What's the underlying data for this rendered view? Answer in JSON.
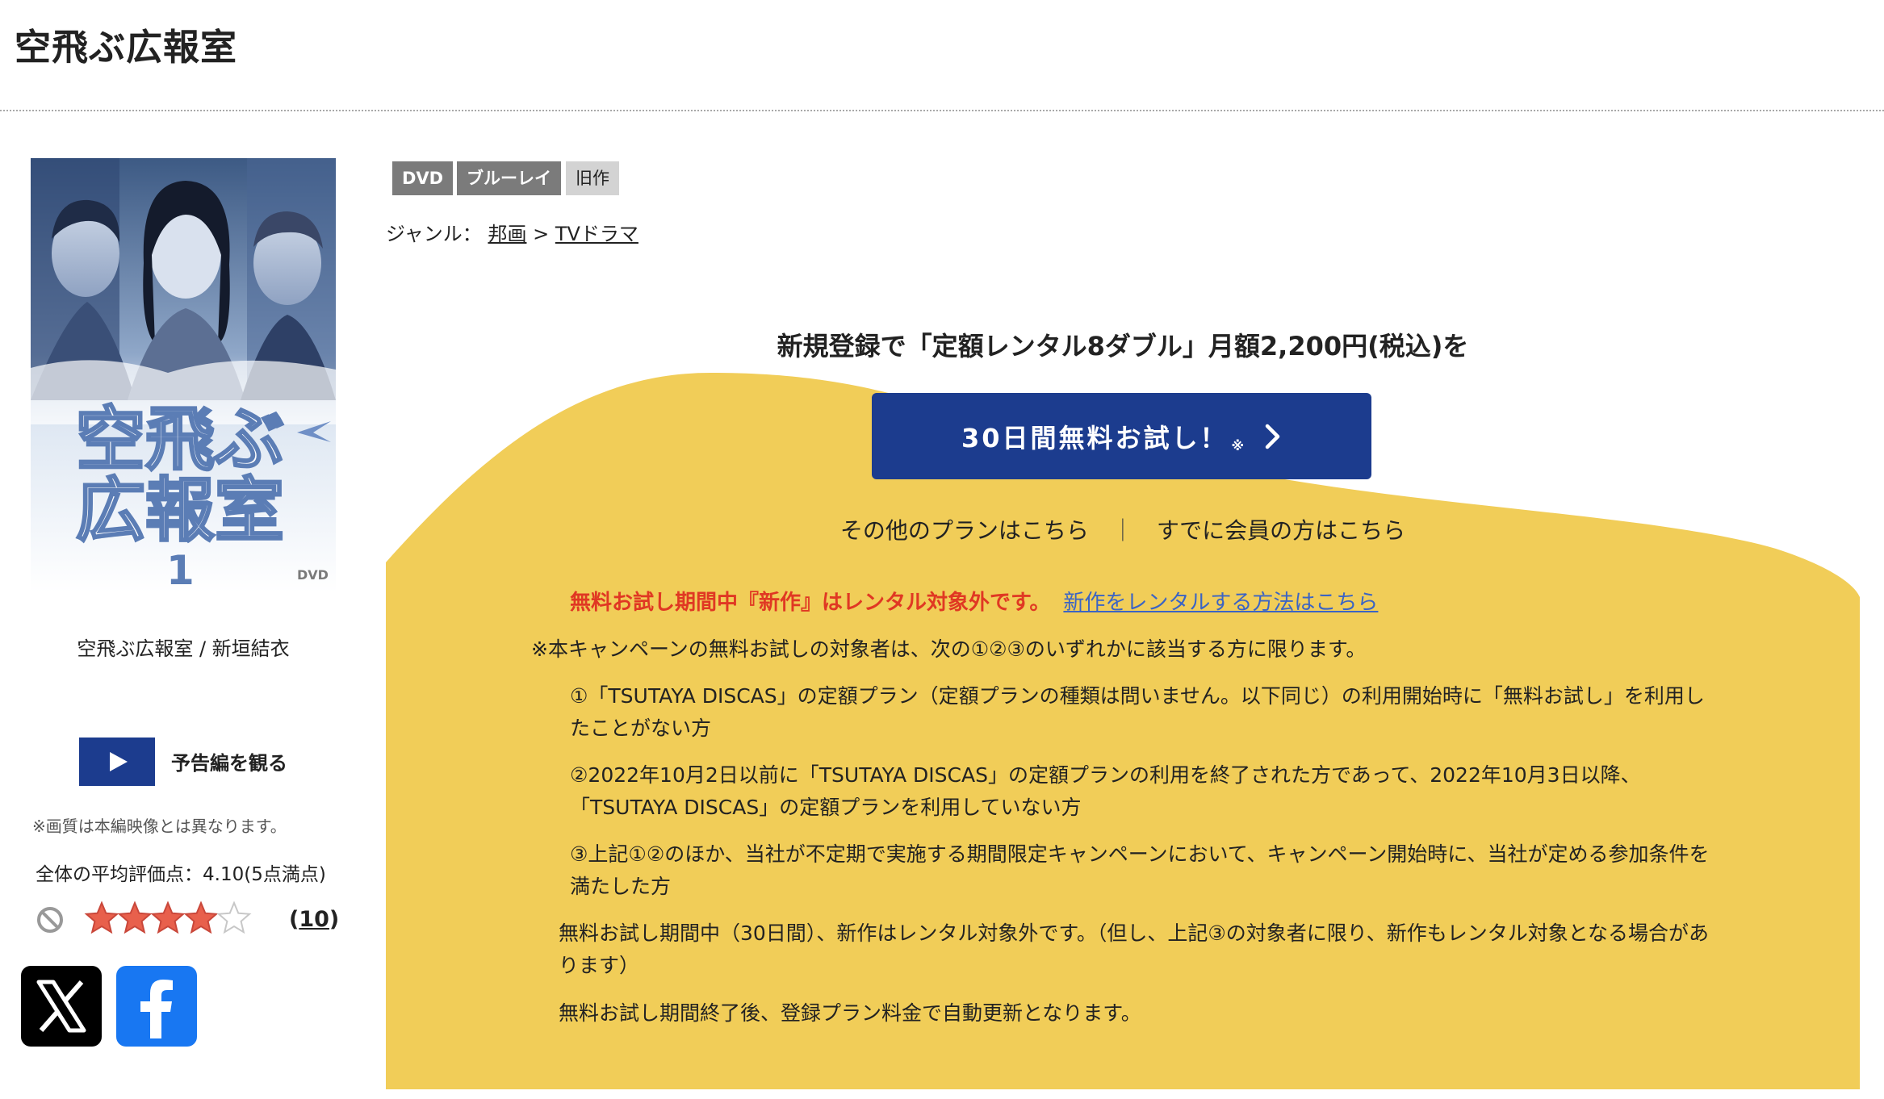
{
  "page": {
    "title": "空飛ぶ広報室"
  },
  "cover": {
    "title_line1": "空飛ぶ",
    "title_line2": "広報室",
    "volume": "1",
    "format_mark": "DVD"
  },
  "product": {
    "caption": "空飛ぶ広報室 / 新垣結衣"
  },
  "trailer": {
    "label": "予告編を観る"
  },
  "image_note": "※画質は本編映像とは異なります。",
  "rating": {
    "avg_label": "全体の平均評価点：",
    "avg_value": "4.10",
    "avg_suffix": "(5点満点)",
    "stars_filled": 4,
    "stars_total": 5,
    "review_count_open": "(",
    "review_count": "10",
    "review_count_close": ")"
  },
  "tags": {
    "dvd": "DVD",
    "bluray": "ブルーレイ",
    "old": "旧作"
  },
  "genre": {
    "label": "ジャンル：",
    "level1": "邦画",
    "separator": ">",
    "level2": "TVドラマ"
  },
  "campaign": {
    "headline": "新規登録で「定額レンタル8ダブル」月額2,200円(税込)を",
    "trial_button": "30日間無料お試し！",
    "trial_mark": "※",
    "other_plans": "その他のプランはこちら",
    "separator": "｜",
    "members": "すでに会員の方はこちら",
    "warning": "無料お試し期間中『新作』はレンタル対象外です。",
    "new_release_link": "新作をレンタルする方法はこちら",
    "note_intro": "※本キャンペーンの無料お試しの対象者は、次の①②③のいずれかに該当する方に限ります。",
    "cond1": "①「TSUTAYA DISCAS」の定額プラン（定額プランの種類は問いません。以下同じ）の利用開始時に「無料お試し」を利用したことがない方",
    "cond2": "②2022年10月2日以前に「TSUTAYA DISCAS」の定額プランの利用を終了された方であって、2022年10月3日以降、「TSUTAYA DISCAS」の定額プランを利用していない方",
    "cond3": "③上記①②のほか、当社が不定期で実施する期間限定キャンペーンにおいて、キャンペーン開始時に、当社が定める参加条件を満たした方",
    "trial_note": "無料お試し期間中（30日間）、新作はレンタル対象外です。（但し、上記③の対象者に限り、新作もレンタル対象となる場合があります）",
    "renew_note": "無料お試し期間終了後、登録プラン料金で自動更新となります。"
  },
  "colors": {
    "accent_blue": "#1c3c8e",
    "panel_yellow": "#f1cd58",
    "warning_red": "#e03823",
    "link_blue": "#3b64c4",
    "star_filled": "#e8604c",
    "x_bg": "#000000",
    "facebook_blue": "#1877f2"
  },
  "icons": {
    "trailer": "play-icon",
    "block": "block-icon",
    "x": "x-logo-icon",
    "facebook": "facebook-logo-icon"
  }
}
